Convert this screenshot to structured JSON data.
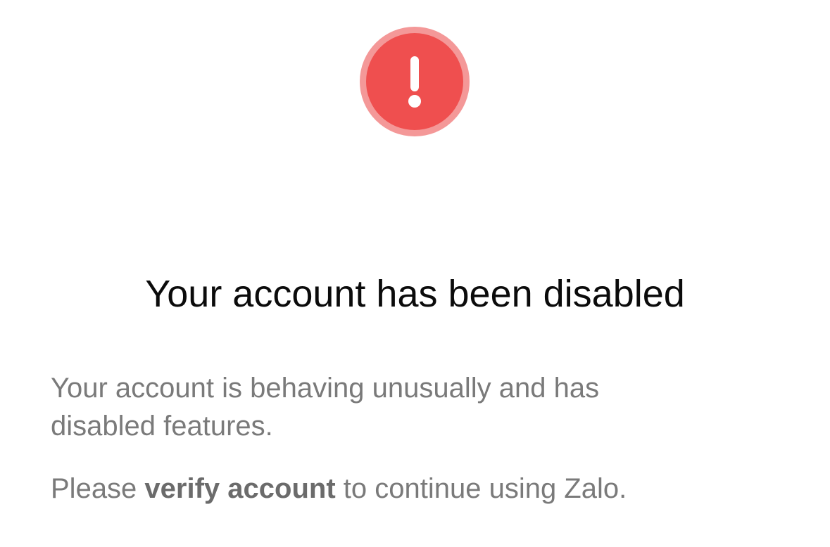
{
  "alert": {
    "icon": "exclamation-icon",
    "outer_color": "#f49898",
    "inner_color": "#ef4f4f"
  },
  "title": "Your account has been disabled",
  "message": {
    "line1": "Your account is behaving unusually and has",
    "line2": "disabled features."
  },
  "instruction": {
    "prefix": "Please ",
    "action": "verify account",
    "suffix": " to continue using Zalo."
  }
}
